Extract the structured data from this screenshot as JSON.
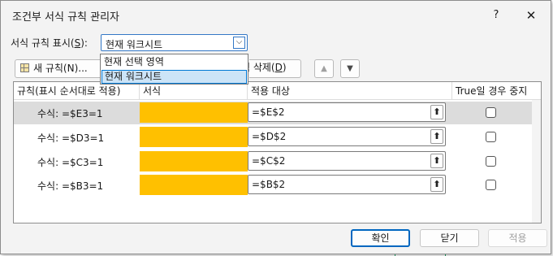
{
  "dialog": {
    "title": "조건부 서식 규칙 관리자",
    "help": "?",
    "close": "✕"
  },
  "show_rules": {
    "label_prefix": "서식 규칙 표시(",
    "label_key": "S",
    "label_suffix": "):",
    "selected_value": "현재 워크시트",
    "dropdown_arrow": "⌵",
    "options": [
      "현재 선택 영역",
      "현재 워크시트"
    ]
  },
  "toolbar": {
    "new_rule": "새 규칙(N)...",
    "delete_rule_prefix": "칙 삭제(",
    "delete_rule_key": "D",
    "delete_rule_suffix": ")",
    "move_up": "▲",
    "move_down": "▼"
  },
  "table": {
    "headers": [
      "규칙(표시 순서대로 적용)",
      "서식",
      "적용 대상",
      "True일 경우 중지"
    ],
    "rows": [
      {
        "rule": "수식: =$E3=1",
        "applies_to": "=$E$2",
        "stop_if_true": false
      },
      {
        "rule": "수식: =$D3=1",
        "applies_to": "=$D$2",
        "stop_if_true": false
      },
      {
        "rule": "수식: =$C3=1",
        "applies_to": "=$C$2",
        "stop_if_true": false
      },
      {
        "rule": "수식: =$B3=1",
        "applies_to": "=$B$2",
        "stop_if_true": false
      }
    ],
    "format_color": "#ffc000",
    "collapse_icon": "⬆"
  },
  "buttons": {
    "ok": "확인",
    "close": "닫기",
    "apply": "적용"
  }
}
